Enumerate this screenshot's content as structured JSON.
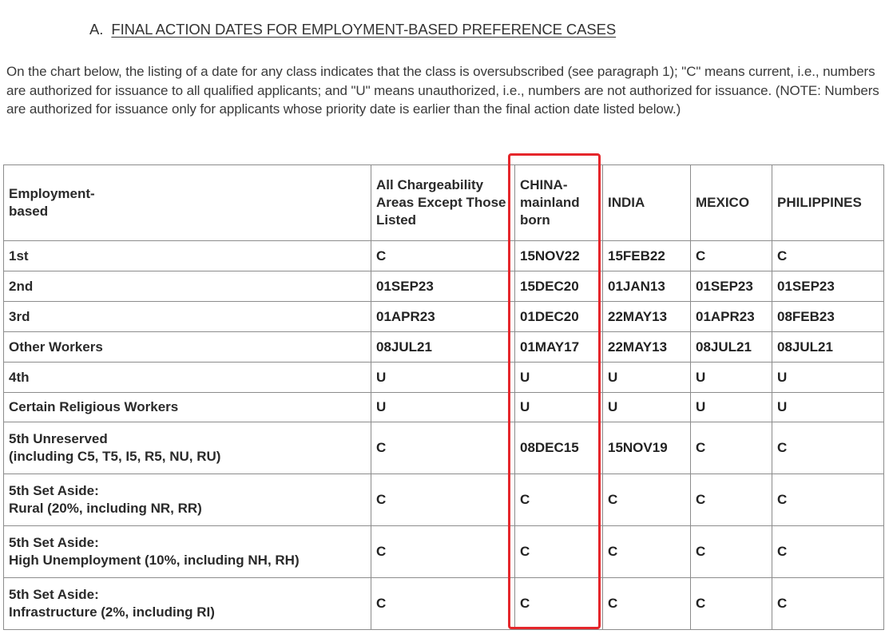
{
  "heading": {
    "prefix": "A.",
    "title": "FINAL ACTION DATES FOR EMPLOYMENT-BASED PREFERENCE CASES"
  },
  "intro": "On the chart below, the listing of a date for any class indicates that the class is oversubscribed (see paragraph 1); \"C\" means current, i.e., numbers are authorized for issuance to all qualified applicants; and \"U\" means unauthorized, i.e., numbers are not authorized for issuance. (NOTE: Numbers are authorized for issuance only for applicants whose priority date is earlier than the final action date listed below.)",
  "table": {
    "headers": [
      "Employment-based",
      "All Chargeability Areas Except Those Listed",
      "CHINA-mainland born",
      "INDIA",
      "MEXICO",
      "PHILIPPINES"
    ],
    "rows": [
      {
        "label": "1st",
        "sublabel": "",
        "values": [
          "C",
          "15NOV22",
          "15FEB22",
          "C",
          "C"
        ]
      },
      {
        "label": "2nd",
        "sublabel": "",
        "values": [
          "01SEP23",
          "15DEC20",
          "01JAN13",
          "01SEP23",
          "01SEP23"
        ]
      },
      {
        "label": "3rd",
        "sublabel": "",
        "values": [
          "01APR23",
          "01DEC20",
          "22MAY13",
          "01APR23",
          "08FEB23"
        ]
      },
      {
        "label": "Other Workers",
        "sublabel": "",
        "values": [
          "08JUL21",
          "01MAY17",
          "22MAY13",
          "08JUL21",
          "08JUL21"
        ]
      },
      {
        "label": "4th",
        "sublabel": "",
        "values": [
          "U",
          "U",
          "U",
          "U",
          "U"
        ]
      },
      {
        "label": "Certain Religious Workers",
        "sublabel": "",
        "values": [
          "U",
          "U",
          "U",
          "U",
          "U"
        ]
      },
      {
        "label": "5th Unreserved",
        "sublabel": "(including C5, T5, I5, R5, NU, RU)",
        "values": [
          "C",
          "08DEC15",
          "15NOV19",
          "C",
          "C"
        ]
      },
      {
        "label": "5th Set Aside:",
        "sublabel": "Rural (20%, including NR, RR)",
        "values": [
          "C",
          "C",
          "C",
          "C",
          "C"
        ]
      },
      {
        "label": "5th Set Aside:",
        "sublabel": "High Unemployment (10%, including NH, RH)",
        "values": [
          "C",
          "C",
          "C",
          "C",
          "C"
        ]
      },
      {
        "label": "5th Set Aside:",
        "sublabel": "Infrastructure (2%, including RI)",
        "values": [
          "C",
          "C",
          "C",
          "C",
          "C"
        ]
      }
    ]
  },
  "annotation": {
    "highlighted_column": "CHINA-mainland born",
    "color": "#e5262b"
  }
}
